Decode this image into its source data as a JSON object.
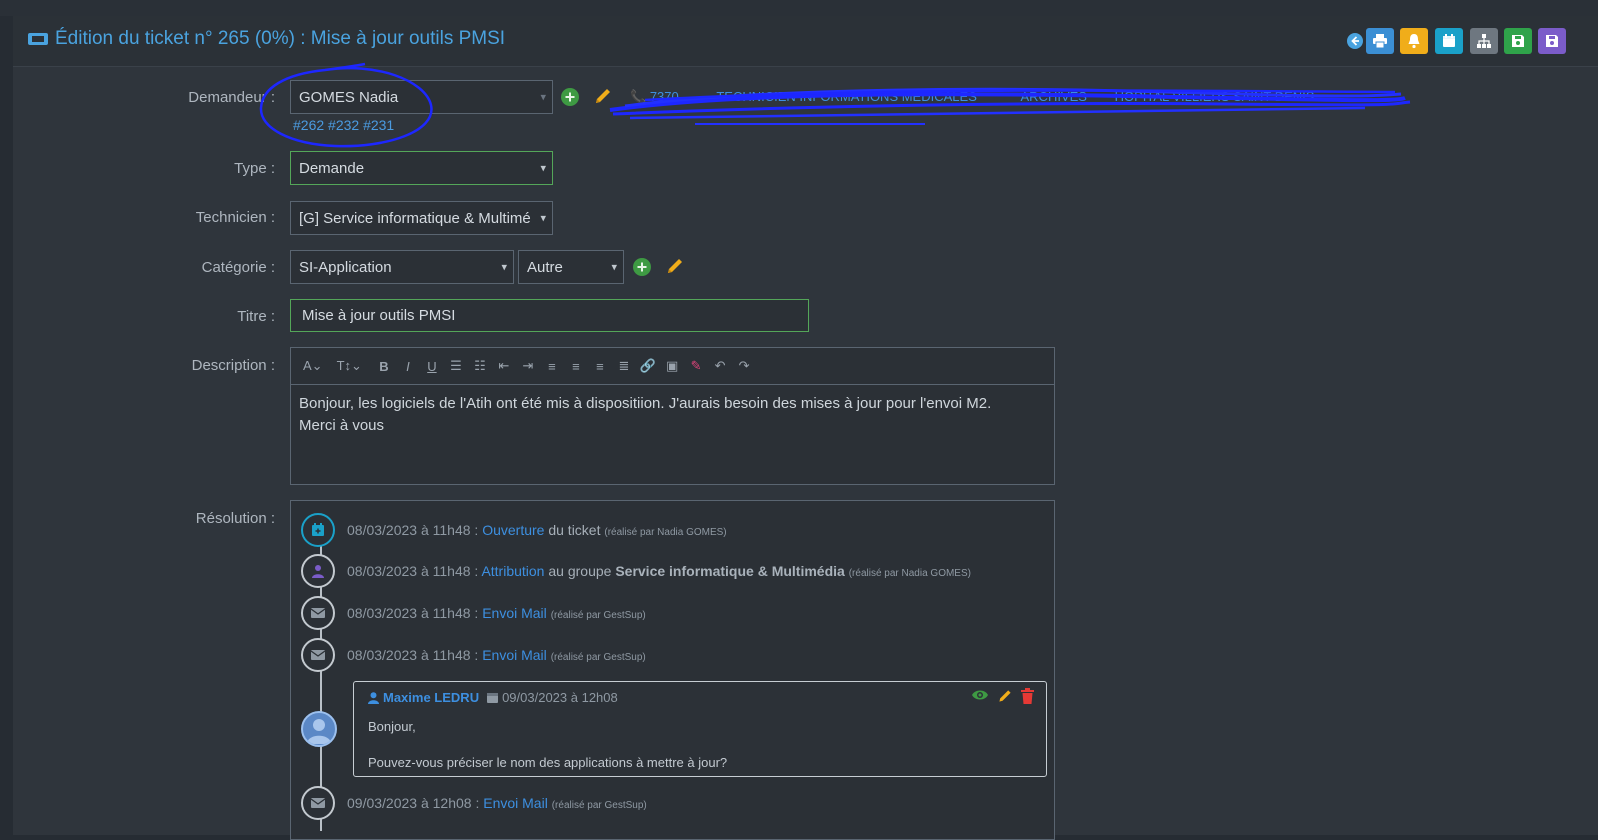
{
  "header": {
    "title": "Édition du ticket n° 265 (0%) : Mise à jour outils PMSI"
  },
  "form": {
    "demandeur_label": "Demandeur :",
    "demandeur_value": "GOMES Nadia",
    "linked_tickets": "#262 #232 #231",
    "contact_phone": "7370",
    "contact_service": "TECHNICIEN INFORMATIONS MÉDICALES",
    "contact_extra": "ARCHIVES",
    "contact_site": "HÔPITAL VILLIERS SAINT DENIS",
    "type_label": "Type :",
    "type_value": "Demande",
    "technicien_label": "Technicien :",
    "technicien_value": "[G] Service informatique & Multimé",
    "categorie_label": "Catégorie :",
    "categorie_value": "SI-Application",
    "subcategorie_value": "Autre",
    "titre_label": "Titre :",
    "titre_value": "Mise à jour outils PMSI",
    "description_label": "Description :",
    "description_line1": "Bonjour, les logiciels de l'Atih ont été mis à dispositiion. J'aurais besoin des mises à jour pour l'envoi M2.",
    "description_line2": "Merci à vous",
    "resolution_label": "Résolution :"
  },
  "timeline": [
    {
      "date": "08/03/2023 à 11h48 :",
      "action": "Ouverture",
      "rest": "du ticket",
      "by": "(réalisé par Nadia GOMES)"
    },
    {
      "date": "08/03/2023 à 11h48 :",
      "action": "Attribution",
      "rest": "au groupe",
      "group": "Service informatique & Multimédia",
      "by": "(réalisé par Nadia GOMES)"
    },
    {
      "date": "08/03/2023 à 11h48 :",
      "action": "Envoi Mail",
      "by": "(réalisé par GestSup)"
    },
    {
      "date": "08/03/2023 à 11h48 :",
      "action": "Envoi Mail",
      "by": "(réalisé par GestSup)"
    },
    {
      "date": "09/03/2023 à 12h08 :",
      "action": "Envoi Mail",
      "by": "(réalisé par GestSup)"
    }
  ],
  "comment": {
    "author": "Maxime LEDRU",
    "date": "09/03/2023 à 12h08",
    "line1": "Bonjour,",
    "line2": "Pouvez-vous préciser le nom des applications à mettre à jour?"
  },
  "colors": {
    "accent": "#4aa3df",
    "success": "#4caf50",
    "warning": "#f0ad1a",
    "danger": "#e53935"
  }
}
